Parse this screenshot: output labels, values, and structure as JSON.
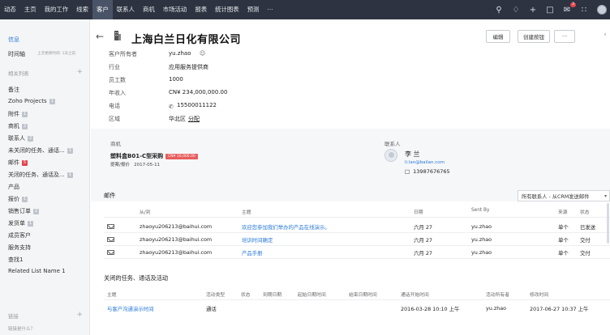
{
  "nav": {
    "items": [
      "动态",
      "主页",
      "我的工作",
      "线索",
      "客户",
      "联系人",
      "商机",
      "市场活动",
      "报表",
      "统计图表",
      "预测",
      "···"
    ],
    "active_index": 4,
    "notification_count": "3"
  },
  "sidebar": {
    "info": "信息",
    "timeline": "时间轴",
    "timeline_sub": "上次更新时间: 1天之前",
    "related_header": "相关列表",
    "items": [
      {
        "label": "备注",
        "count": ""
      },
      {
        "label": "Zoho Projects",
        "count": "1"
      },
      {
        "label": "附件",
        "count": "1"
      },
      {
        "label": "商机",
        "count": "2"
      },
      {
        "label": "联系人",
        "count": "2"
      },
      {
        "label": "未关闭的任务、通话...",
        "count": "1"
      },
      {
        "label": "邮件",
        "count": "5"
      },
      {
        "label": "关闭的任务、通话及...",
        "count": "1"
      },
      {
        "label": "产品",
        "count": ""
      },
      {
        "label": "报价",
        "count": "1"
      },
      {
        "label": "销售订单",
        "count": "2"
      },
      {
        "label": "发货单",
        "count": "1"
      },
      {
        "label": "成员客户",
        "count": ""
      },
      {
        "label": "服务支持",
        "count": ""
      },
      {
        "label": "查找1",
        "count": ""
      },
      {
        "label": "Related List Name 1",
        "count": ""
      }
    ],
    "links_header": "链接",
    "links_sub": "链接是什么？"
  },
  "record": {
    "title": "上海白兰日化有限公司",
    "edit_button": "编辑",
    "create_button": "创建按钮",
    "more_button": "···",
    "fields": [
      {
        "label": "客户所有者",
        "value": "yu.zhao"
      },
      {
        "label": "行业",
        "value": "应用服务提供商"
      },
      {
        "label": "员工数",
        "value": "1000"
      },
      {
        "label": "年收入",
        "value": "CN¥ 234,000,000.00"
      },
      {
        "label": "电话",
        "value": "15500011122"
      },
      {
        "label": "区域",
        "value": "华北区",
        "extra": "分配"
      }
    ]
  },
  "deals": {
    "header": "商机",
    "name": "塑料盒B01-C型采购",
    "tag": "CN¥ 10,000.00",
    "stage": "提案/报价",
    "date": "2017-05-11"
  },
  "contact": {
    "header": "联系人",
    "name": "李 兰",
    "email": "li.lan@bailan.com",
    "phone": "13987676765"
  },
  "mails": {
    "title": "邮件",
    "filter": "所有联系人 - 从CRM发送邮件",
    "headers": [
      "从/到",
      "主题",
      "日期",
      "Sent By",
      "来源",
      "状态"
    ],
    "rows": [
      {
        "from": "zhaoyu206213@baihui.com",
        "subject": "欢迎您参加我们举办的产品在线演示。",
        "date": "六月 27",
        "sent_by": "yu.zhao",
        "source": "单个",
        "status": "已发送"
      },
      {
        "from": "zhaoyu206213@baihui.com",
        "subject": "培训时间确定",
        "date": "六月 27",
        "sent_by": "yu.zhao",
        "source": "单个",
        "status": "交付"
      },
      {
        "from": "zhaoyu206213@baihui.com",
        "subject": "产品手册",
        "date": "六月 27",
        "sent_by": "yu.zhao",
        "source": "单个",
        "status": "交付"
      }
    ]
  },
  "closed_activities": {
    "title": "关闭的任务、通话及活动",
    "headers": [
      "主题",
      "活动类型",
      "状态",
      "到期日期",
      "起始日期时间",
      "结束日期时间",
      "通话开始时间",
      "活动所有者",
      "修改时间"
    ],
    "rows": [
      {
        "subject": "与客户沟通演示时间",
        "type": "通话",
        "call_start": "2016-03-28 10:10 上午",
        "owner": "yu.zhao",
        "modified": "2017-06-27 10:37 上午"
      }
    ]
  }
}
